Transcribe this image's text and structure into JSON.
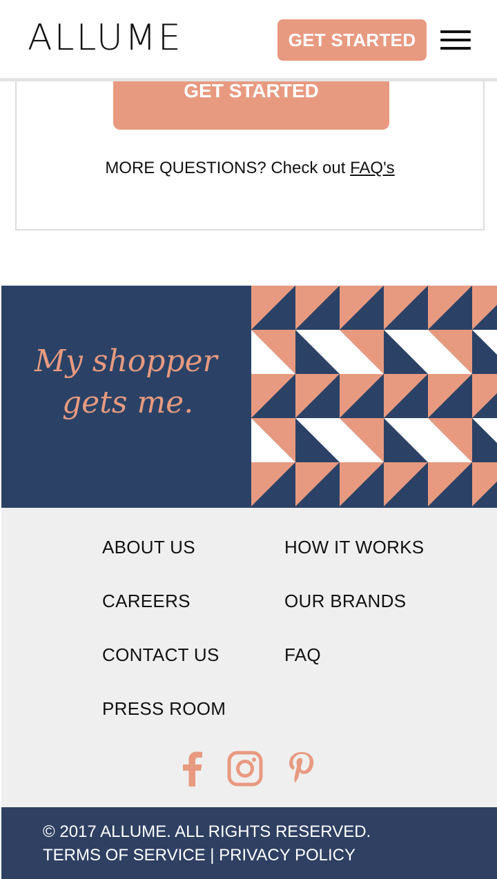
{
  "header": {
    "logo": "ALLUME",
    "cta_label": "GET STARTED",
    "menu_icon": "hamburger-menu-icon"
  },
  "cta_section": {
    "button_label": "GET STARTED",
    "questions_text": "MORE QUESTIONS? Check out ",
    "faq_link": "FAQ's"
  },
  "banner": {
    "tagline_line1": "My shopper",
    "tagline_line2": "gets me."
  },
  "footer": {
    "links": [
      {
        "label": "ABOUT US"
      },
      {
        "label": "HOW IT WORKS"
      },
      {
        "label": "CAREERS"
      },
      {
        "label": "OUR BRANDS"
      },
      {
        "label": "CONTACT US"
      },
      {
        "label": "FAQ"
      },
      {
        "label": "PRESS ROOM"
      }
    ],
    "social": [
      "facebook-icon",
      "instagram-icon",
      "pinterest-icon"
    ]
  },
  "bottom": {
    "copyright": "© 2017 ALLUME. ALL RIGHTS RESERVED.",
    "terms": "TERMS OF SERVICE",
    "separator": "|",
    "privacy": "PRIVACY POLICY"
  },
  "colors": {
    "accent": "#e89a80",
    "navy": "#2b4266",
    "footer_bg": "#efefef"
  }
}
